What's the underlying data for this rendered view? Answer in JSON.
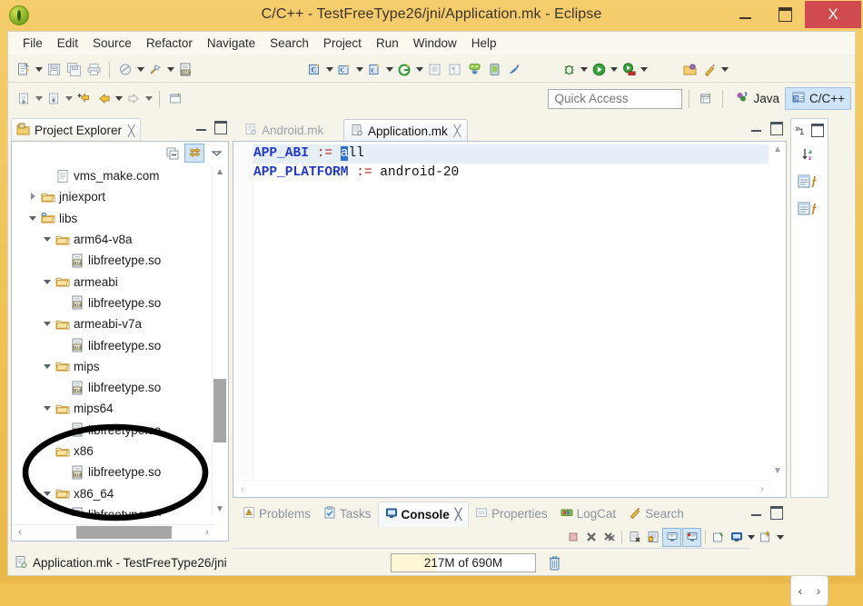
{
  "window": {
    "title": "C/C++ - TestFreeType26/jni/Application.mk - Eclipse",
    "logo_icon": "eclipse-logo-icon",
    "minimize_label": "Minimize",
    "maximize_label": "Maximize",
    "close_label": "X"
  },
  "menubar": {
    "items": [
      "File",
      "Edit",
      "Source",
      "Refactor",
      "Navigate",
      "Search",
      "Project",
      "Run",
      "Window",
      "Help"
    ]
  },
  "toolbar": {
    "row1": [
      {
        "name": "new-file-icon",
        "caret": true
      },
      {
        "name": "save-icon",
        "caret": false
      },
      {
        "name": "save-all-icon",
        "caret": false
      },
      {
        "name": "print-icon",
        "caret": false
      },
      {
        "name": "separator"
      },
      {
        "name": "build-all-icon",
        "caret": true
      },
      {
        "name": "hammer-build-icon",
        "caret": true
      },
      {
        "name": "binary-010-icon",
        "caret": false
      },
      {
        "name": "new-c-class-icon",
        "caret": true
      },
      {
        "name": "new-c-project-icon",
        "caret": true
      },
      {
        "name": "new-c-file-icon",
        "caret": true
      },
      {
        "name": "new-gradle-icon",
        "caret": true
      },
      {
        "name": "open-type-icon",
        "caret": false
      },
      {
        "name": "paragraph-icon",
        "caret": false
      },
      {
        "name": "android-sdk-manager-icon",
        "caret": false
      },
      {
        "name": "android-avd-manager-icon",
        "caret": false
      },
      {
        "name": "lint-icon",
        "caret": false
      },
      {
        "name": "debug-icon",
        "caret": true
      },
      {
        "name": "run-icon",
        "caret": true
      },
      {
        "name": "run-external-tools-icon",
        "caret": true
      },
      {
        "name": "open-perspective-icon",
        "caret": false
      },
      {
        "name": "skip-breakpoints-icon",
        "caret": true
      }
    ],
    "row2": [
      {
        "name": "next-annotation-icon",
        "caret": true
      },
      {
        "name": "previous-annotation-icon",
        "caret": true
      },
      {
        "name": "last-edit-location-icon",
        "caret": false
      },
      {
        "name": "back-icon",
        "caret": true
      },
      {
        "name": "forward-icon",
        "caret": true
      },
      {
        "name": "separator"
      },
      {
        "name": "new-window-icon",
        "caret": false
      }
    ]
  },
  "quick_access": {
    "placeholder": "Quick Access",
    "value": "",
    "new-perspective-icon": "new-perspective-icon"
  },
  "perspectives": [
    {
      "label": "Java",
      "icon": "java-perspective-icon",
      "active": false
    },
    {
      "label": "C/C++",
      "icon": "cpp-perspective-icon",
      "active": true
    }
  ],
  "project_explorer": {
    "tab_label": "Project Explorer",
    "tab_icon": "project-explorer-icon",
    "close_icon": "close-icon",
    "toolbar": [
      {
        "name": "collapse-all-icon",
        "selected": false
      },
      {
        "name": "link-with-editor-icon",
        "selected": true
      },
      {
        "name": "view-menu-icon",
        "selected": false
      }
    ],
    "tree": [
      {
        "label": "vms_make.com",
        "indent": 3,
        "arrow": "none",
        "icon": "text-file-icon"
      },
      {
        "label": "jniexport",
        "indent": 2,
        "arrow": "closed",
        "icon": "folder-icon"
      },
      {
        "label": "libs",
        "indent": 2,
        "arrow": "open",
        "icon": "source-folder-icon"
      },
      {
        "label": "arm64-v8a",
        "indent": 3,
        "arrow": "open",
        "icon": "folder-icon"
      },
      {
        "label": "libfreetype.so",
        "indent": 4,
        "arrow": "none",
        "icon": "binary-file-icon"
      },
      {
        "label": "armeabi",
        "indent": 3,
        "arrow": "open",
        "icon": "folder-icon"
      },
      {
        "label": "libfreetype.so",
        "indent": 4,
        "arrow": "none",
        "icon": "binary-file-icon"
      },
      {
        "label": "armeabi-v7a",
        "indent": 3,
        "arrow": "open",
        "icon": "folder-icon"
      },
      {
        "label": "libfreetype.so",
        "indent": 4,
        "arrow": "none",
        "icon": "binary-file-icon"
      },
      {
        "label": "mips",
        "indent": 3,
        "arrow": "open",
        "icon": "folder-icon"
      },
      {
        "label": "libfreetype.so",
        "indent": 4,
        "arrow": "none",
        "icon": "binary-file-icon"
      },
      {
        "label": "mips64",
        "indent": 3,
        "arrow": "open",
        "icon": "folder-icon"
      },
      {
        "label": "libfreetype.so",
        "indent": 4,
        "arrow": "none",
        "icon": "binary-file-icon"
      },
      {
        "label": "x86",
        "indent": 3,
        "arrow": "none",
        "icon": "folder-icon"
      },
      {
        "label": "libfreetype.so",
        "indent": 4,
        "arrow": "none",
        "icon": "binary-file-icon"
      },
      {
        "label": "x86_64",
        "indent": 3,
        "arrow": "open",
        "icon": "folder-icon"
      },
      {
        "label": "libfreetype.so",
        "indent": 4,
        "arrow": "none",
        "icon": "binary-file-icon"
      }
    ]
  },
  "editor": {
    "tabs": [
      {
        "label": "Android.mk",
        "active": false,
        "icon": "makefile-icon"
      },
      {
        "label": "Application.mk",
        "active": true,
        "icon": "makefile-icon",
        "close_icon": "close-icon"
      }
    ],
    "lines": [
      {
        "key": "APP_ABI",
        "op": " := ",
        "sel": "a",
        "rest": "ll",
        "current": true
      },
      {
        "key": "APP_PLATFORM",
        "op": " := ",
        "sel": "",
        "rest": "android-20",
        "current": false
      }
    ],
    "full_text": "APP_ABI :=all\nAPP_PLATFORM := android-20"
  },
  "right_stack": {
    "chevrons": "»",
    "count": "1",
    "items": [
      {
        "name": "outline-sort-icon"
      },
      {
        "name": "outline-view-icon"
      },
      {
        "name": "make-target-view-icon"
      }
    ],
    "nav_prev": "‹",
    "nav_next": "›"
  },
  "bottom_panel": {
    "tabs": [
      {
        "label": "Problems",
        "icon": "problems-icon",
        "active": false
      },
      {
        "label": "Tasks",
        "icon": "tasks-icon",
        "active": false
      },
      {
        "label": "Console",
        "icon": "console-icon",
        "active": true,
        "close_icon": "close-icon"
      },
      {
        "label": "Properties",
        "icon": "properties-icon",
        "active": false
      },
      {
        "label": "LogCat",
        "icon": "logcat-icon",
        "active": false
      },
      {
        "label": "Search",
        "icon": "search-icon",
        "active": false
      }
    ],
    "toolbar": [
      {
        "name": "terminate-icon",
        "on": false
      },
      {
        "name": "remove-launch-icon",
        "on": false
      },
      {
        "name": "remove-all-terminated-icon",
        "on": false
      },
      {
        "name": "separator"
      },
      {
        "name": "clear-console-icon",
        "on": false
      },
      {
        "name": "scroll-lock-icon",
        "on": false
      },
      {
        "name": "show-console-on-output-icon",
        "on": true
      },
      {
        "name": "show-console-on-error-icon",
        "on": true
      },
      {
        "name": "separator"
      },
      {
        "name": "pin-console-icon",
        "on": false
      },
      {
        "name": "display-selected-console-icon",
        "on": false,
        "caret": true
      },
      {
        "name": "open-console-icon",
        "on": false,
        "caret": true
      }
    ]
  },
  "status_bar": {
    "file_icon": "makefile-icon",
    "text": "Application.mk - TestFreeType26/jni",
    "heap": "217M of 690M",
    "heap_percent": 31,
    "trash_icon": "trash-icon"
  },
  "annotation": {
    "type": "ellipse-highlight",
    "targets": [
      "x86",
      "libfreetype.so",
      "x86_64",
      "libfreetype.so"
    ],
    "color": "#000000"
  },
  "colors": {
    "title_bg": "#f0c254",
    "close_btn": "#cf4b50",
    "accent_selection": "#2f6fd0",
    "keyword": "#2138c8",
    "operator": "#b02020",
    "active_tab": "#cfe4f7"
  }
}
